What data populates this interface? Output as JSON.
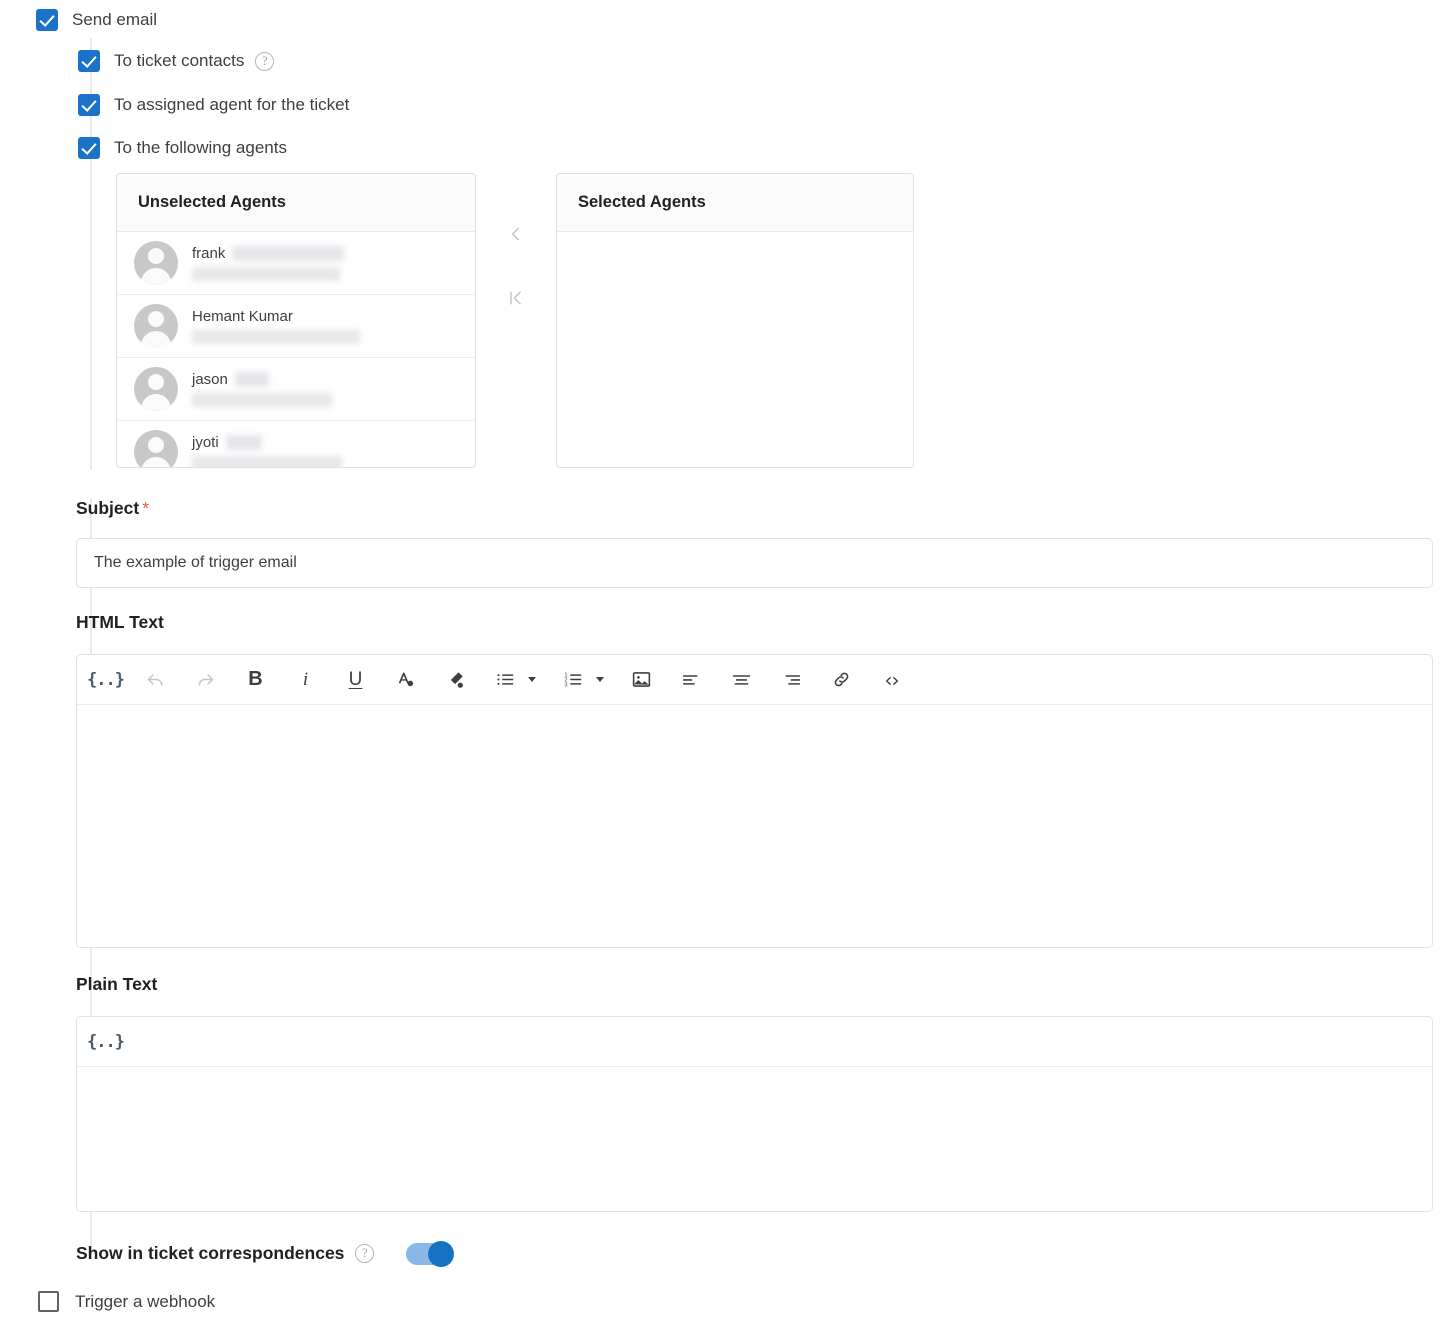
{
  "send_email": {
    "label": "Send email",
    "checked": true,
    "options": [
      {
        "label": "To ticket contacts",
        "checked": true,
        "help": "?"
      },
      {
        "label": "To assigned agent for the ticket",
        "checked": true
      },
      {
        "label": "To the following agents",
        "checked": true
      }
    ]
  },
  "agent_picker": {
    "unselected_title": "Unselected Agents",
    "selected_title": "Selected Agents",
    "unselected_agents": [
      {
        "name": "frank",
        "redacted_name": true,
        "redacted_email": true
      },
      {
        "name": "Hemant Kumar",
        "redacted_name": false,
        "redacted_email": true
      },
      {
        "name": "jason",
        "redacted_name": true,
        "redacted_email": true
      },
      {
        "name": "jyoti",
        "redacted_name": true,
        "redacted_email": true
      }
    ],
    "selected_agents": [],
    "move_left_icon": "chevron-left-icon",
    "move_all_left_icon": "first-page-left-icon"
  },
  "subject": {
    "label": "Subject",
    "required_marker": "*",
    "value": "The example of trigger email",
    "placeholder": ""
  },
  "html_text": {
    "label": "HTML Text",
    "value": "",
    "toolbar": [
      {
        "name": "placeholder-icon",
        "glyph": "{..}",
        "state": "placeholder"
      },
      {
        "name": "undo-icon",
        "glyph": "undo",
        "state": "disabled"
      },
      {
        "name": "redo-icon",
        "glyph": "redo",
        "state": "disabled"
      },
      {
        "name": "bold-icon",
        "glyph": "B",
        "state": "normal"
      },
      {
        "name": "italic-icon",
        "glyph": "i",
        "state": "normal"
      },
      {
        "name": "underline-icon",
        "glyph": "U",
        "state": "normal"
      },
      {
        "name": "text-color-icon",
        "glyph": "A",
        "state": "normal"
      },
      {
        "name": "highlight-color-icon",
        "glyph": "marker",
        "state": "normal"
      },
      {
        "name": "bulleted-list-icon",
        "glyph": "ul",
        "state": "normal"
      },
      {
        "name": "bulleted-list-dropdown-icon",
        "glyph": "caret",
        "state": "normal"
      },
      {
        "name": "numbered-list-icon",
        "glyph": "ol",
        "state": "normal"
      },
      {
        "name": "numbered-list-dropdown-icon",
        "glyph": "caret",
        "state": "normal"
      },
      {
        "name": "insert-image-icon",
        "glyph": "image",
        "state": "normal"
      },
      {
        "name": "align-left-icon",
        "glyph": "align-left",
        "state": "normal"
      },
      {
        "name": "align-center-icon",
        "glyph": "align-center",
        "state": "normal"
      },
      {
        "name": "align-right-icon",
        "glyph": "align-right",
        "state": "normal"
      },
      {
        "name": "insert-link-icon",
        "glyph": "link",
        "state": "normal"
      },
      {
        "name": "source-code-icon",
        "glyph": "<>",
        "state": "normal"
      }
    ]
  },
  "plain_text": {
    "label": "Plain Text",
    "value": "",
    "toolbar": [
      {
        "name": "placeholder-icon",
        "glyph": "{..}",
        "state": "placeholder"
      }
    ]
  },
  "show_in_correspondences": {
    "label": "Show in ticket correspondences",
    "help": "?",
    "enabled": true
  },
  "trigger_webhook": {
    "label": "Trigger a webhook",
    "checked": false
  },
  "colors": {
    "checkbox_blue": "#1a73c8",
    "toggle_track": "#8ab9e8",
    "toggle_knob": "#1673c4",
    "required_red": "#e8574a",
    "text": "#3c4043",
    "border": "#e0e2e5"
  }
}
